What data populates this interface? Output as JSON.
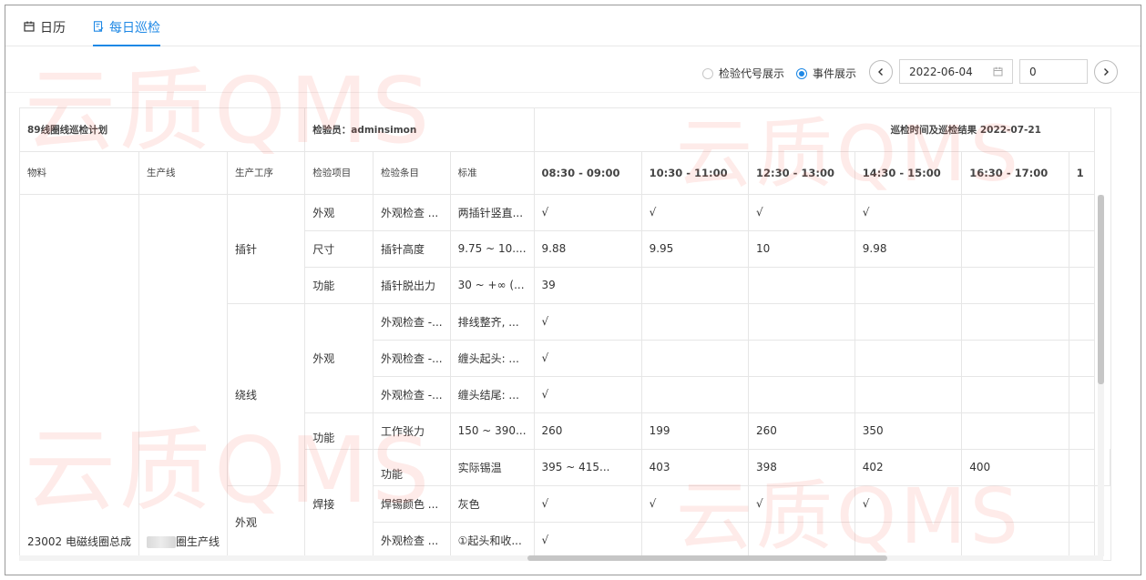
{
  "tabs": {
    "calendar": {
      "label": "日历",
      "icon": "calendar-icon"
    },
    "daily": {
      "label": "每日巡检",
      "icon": "inspection-doc-icon"
    }
  },
  "toolbar": {
    "radio_code": "检验代号展示",
    "radio_event": "事件展示",
    "selected": "event",
    "date_value": "2022-06-04",
    "number_value": "0"
  },
  "table": {
    "plan_title": "89线圈线巡检计划",
    "inspector": "检验员：adminsimon",
    "result_title": "巡检时间及巡检结果 2022-07-21",
    "headers": {
      "material": "物料",
      "line": "生产线",
      "process": "生产工序",
      "item": "检验项目",
      "condition": "检验条目",
      "standard": "标准"
    },
    "slots": [
      "08:30 - 09:00",
      "10:30 - 11:00",
      "12:30 - 13:00",
      "14:30 - 15:00",
      "16:30 - 17:00",
      "1"
    ],
    "material": "23002 电磁线圈总成",
    "line_suffix": "圈生产线",
    "processes": {
      "p1": "插针",
      "p2": "绕线",
      "p3": "焊接"
    },
    "rows": [
      {
        "item": "外观",
        "condition": "外观检查 ...",
        "standard": "两插针竖直...",
        "values": [
          "√",
          "√",
          "√",
          "√",
          ""
        ]
      },
      {
        "item": "尺寸",
        "condition": "插针高度",
        "standard": "9.75 ~ 10....",
        "values": [
          "9.88",
          "9.95",
          "10",
          "9.98",
          ""
        ]
      },
      {
        "item": "功能",
        "condition": "插针脱出力",
        "standard": "30 ~ +∞ (...",
        "values": [
          "39",
          "",
          "",
          "",
          ""
        ]
      },
      {
        "item": "外观",
        "condition": "外观检查 -...",
        "standard": "排线整齐, ...",
        "values": [
          "√",
          "",
          "",
          "",
          ""
        ]
      },
      {
        "item": "",
        "condition": "外观检查 -...",
        "standard": "缠头起头: ...",
        "values": [
          "√",
          "",
          "",
          "",
          ""
        ]
      },
      {
        "item": "",
        "condition": "外观检查 -...",
        "standard": "缠头结尾: ...",
        "values": [
          "√",
          "",
          "",
          "",
          ""
        ]
      },
      {
        "item": "功能",
        "condition": "工作张力",
        "standard": "150 ~ 390...",
        "values": [
          "260",
          "199",
          "260",
          "350",
          ""
        ]
      },
      {
        "item": "功能",
        "condition": "实际锡温",
        "standard": "395 ~ 415...",
        "values": [
          "403",
          "398",
          "402",
          "400",
          ""
        ]
      },
      {
        "item": "外观",
        "condition": "焊锡颜色 ...",
        "standard": "灰色",
        "values": [
          "√",
          "√",
          "√",
          "√",
          ""
        ]
      },
      {
        "item": "",
        "condition": "外观检查 ...",
        "standard": "①起头和收...",
        "values": [
          "√",
          "",
          "",
          "",
          ""
        ]
      }
    ]
  },
  "watermark": "云质QMS",
  "colors": {
    "accent": "#1e88e5",
    "watermark": "#f45a46"
  }
}
